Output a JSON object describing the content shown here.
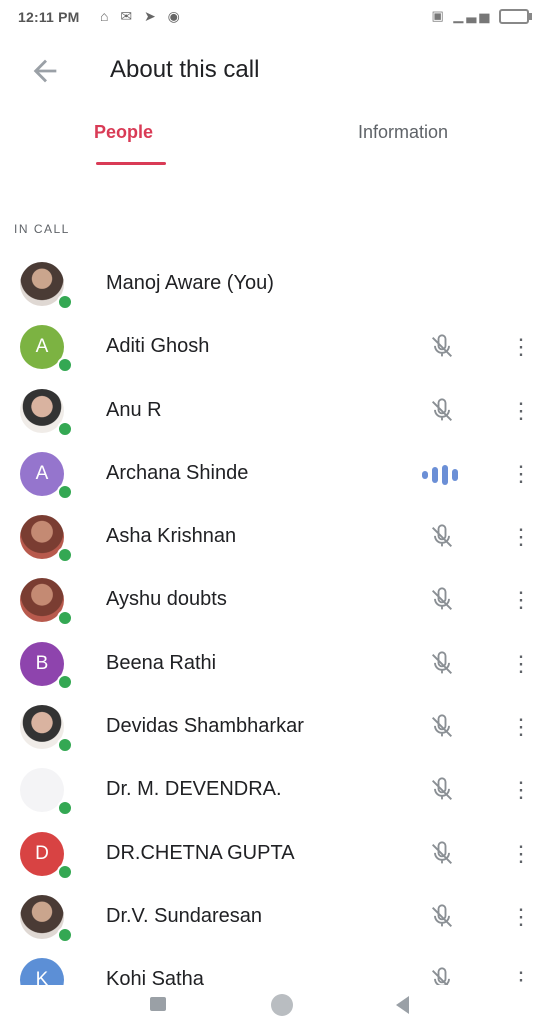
{
  "status_bar": {
    "time": "12:11 PM",
    "left_icons": "⌂ ✉ ➤ ◉",
    "right_icons": "▣ ▁▃▅"
  },
  "app_bar": {
    "title": "About this call"
  },
  "tabs": [
    {
      "label": "People",
      "selected": true
    },
    {
      "label": "Information",
      "selected": false
    }
  ],
  "section_label": "IN CALL",
  "participants": [
    {
      "name": "Manoj Aware (You)",
      "avatar": "photo",
      "mic": "none"
    },
    {
      "name": "Aditi Ghosh",
      "avatar_letter": "A",
      "avatar_color": "#7cb342",
      "mic": "muted"
    },
    {
      "name": "Anu R",
      "avatar": "photo",
      "mic": "muted"
    },
    {
      "name": "Archana Shinde",
      "avatar_letter": "A",
      "avatar_color": "#9575cd",
      "mic": "speaking"
    },
    {
      "name": "Asha Krishnan",
      "avatar": "photo",
      "mic": "muted"
    },
    {
      "name": "Ayshu doubts",
      "avatar": "photo",
      "mic": "muted"
    },
    {
      "name": "Beena Rathi",
      "avatar_letter": "B",
      "avatar_color": "#8e44ad",
      "mic": "muted"
    },
    {
      "name": "Devidas Shambharkar",
      "avatar": "photo",
      "mic": "muted"
    },
    {
      "name": "Dr. M. DEVENDRA.",
      "avatar": "logo",
      "mic": "muted"
    },
    {
      "name": "DR.CHETNA GUPTA",
      "avatar_letter": "D",
      "avatar_color": "#d84343",
      "mic": "muted"
    },
    {
      "name": "Dr.V. Sundaresan",
      "avatar": "photo",
      "mic": "muted"
    },
    {
      "name": "Kohi Satha",
      "avatar_letter": "K",
      "avatar_color": "#5c8fd6",
      "mic": "muted"
    }
  ],
  "colors": {
    "accent": "#d93b56",
    "online": "#34a853",
    "speaking": "#6b8fd6"
  }
}
